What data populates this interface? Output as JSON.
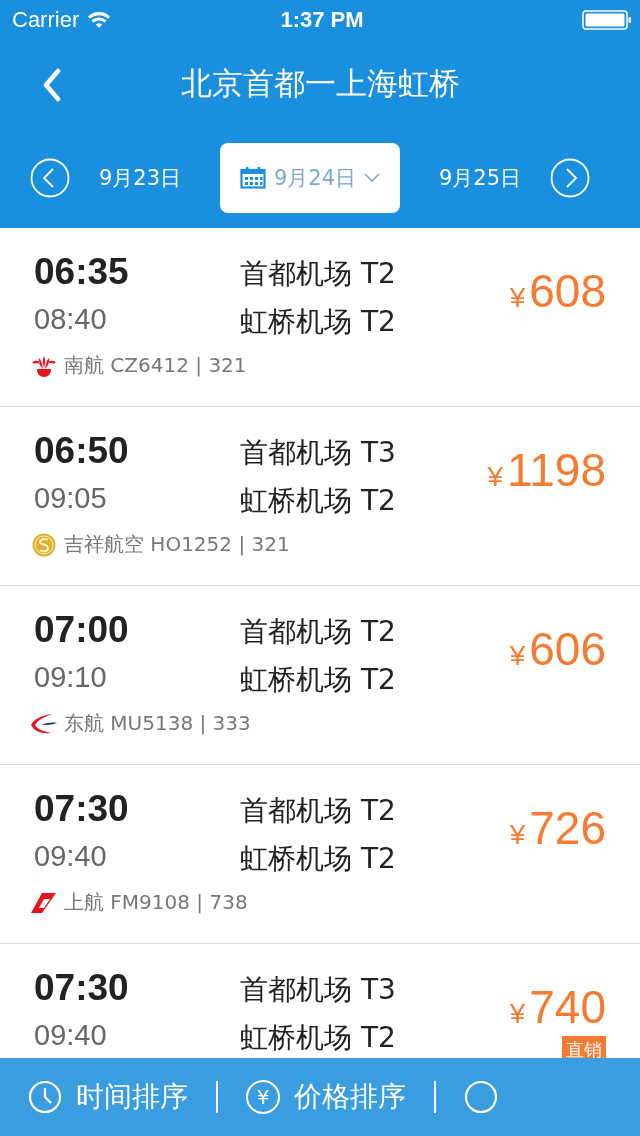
{
  "status_bar": {
    "carrier": "Carrier",
    "time": "1:37 PM"
  },
  "header": {
    "title": "北京首都一上海虹桥"
  },
  "dates": [
    {
      "label": "9月23日",
      "selected": false
    },
    {
      "label": "9月24日",
      "selected": true
    },
    {
      "label": "9月25日",
      "selected": false
    }
  ],
  "flights": [
    {
      "depart": "06:35",
      "arrive": "08:40",
      "from": "首都机场 T2",
      "to": "虹桥机场 T2",
      "price": "608",
      "currency": "¥",
      "airline": {
        "kind": "csair",
        "text": "南航 CZ6412 | 321"
      }
    },
    {
      "depart": "06:50",
      "arrive": "09:05",
      "from": "首都机场 T3",
      "to": "虹桥机场 T2",
      "price": "1198",
      "currency": "¥",
      "airline": {
        "kind": "juneyao",
        "text": "吉祥航空 HO1252 | 321"
      }
    },
    {
      "depart": "07:00",
      "arrive": "09:10",
      "from": "首都机场 T2",
      "to": "虹桥机场 T2",
      "price": "606",
      "currency": "¥",
      "airline": {
        "kind": "ceair",
        "text": "东航 MU5138 | 333"
      }
    },
    {
      "depart": "07:30",
      "arrive": "09:40",
      "from": "首都机场 T2",
      "to": "虹桥机场 T2",
      "price": "726",
      "currency": "¥",
      "airline": {
        "kind": "shair",
        "text": "上航 FM9108 | 738"
      }
    },
    {
      "depart": "07:30",
      "arrive": "09:40",
      "from": "首都机场 T3",
      "to": "虹桥机场 T2",
      "price": "740",
      "currency": "¥",
      "badge": "直销"
    }
  ],
  "sort_bar": [
    {
      "kind": "time",
      "label": "时间排序"
    },
    {
      "kind": "price",
      "label": "价格排序",
      "icon_text": "¥"
    },
    {
      "kind": "filter"
    }
  ]
}
